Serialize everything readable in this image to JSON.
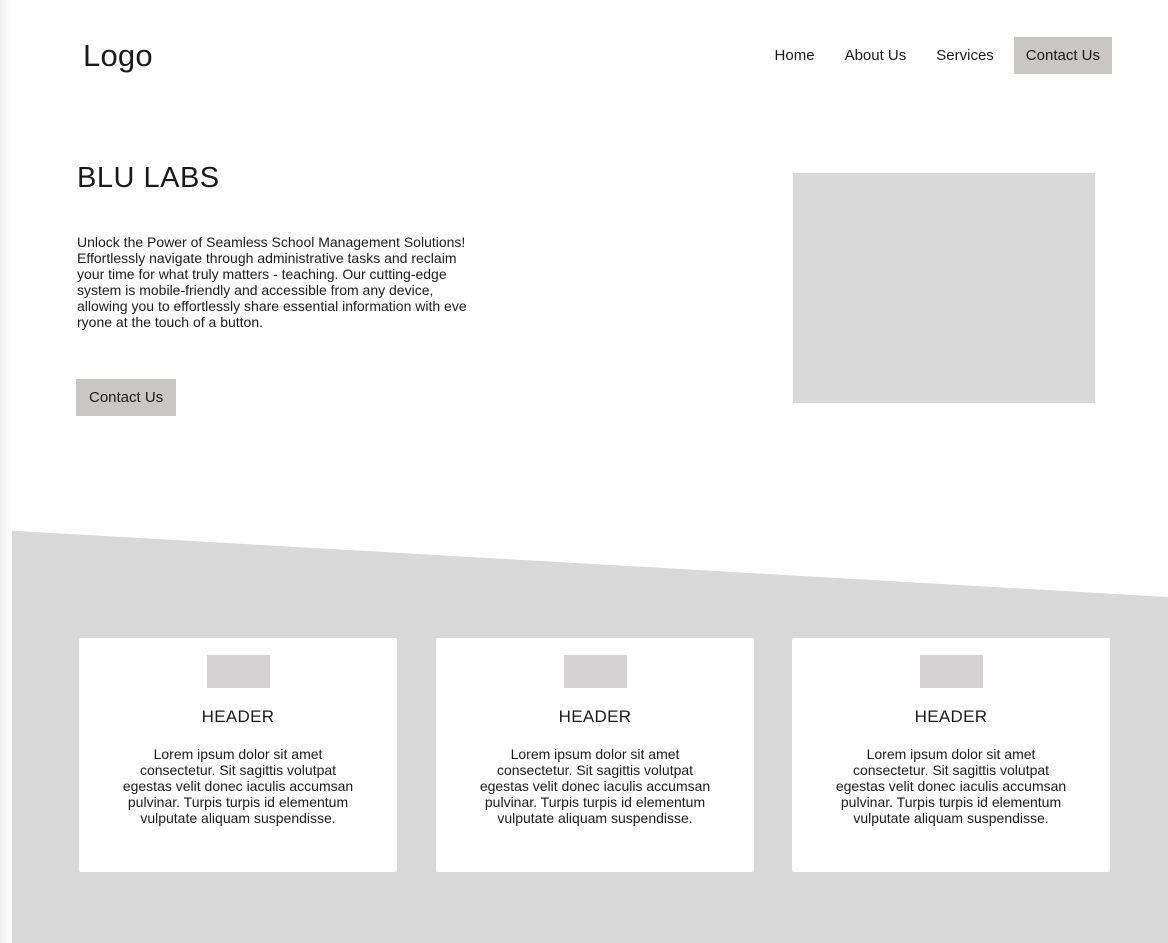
{
  "header": {
    "logo": "Logo",
    "nav": [
      {
        "label": "Home"
      },
      {
        "label": "About Us"
      },
      {
        "label": "Services"
      },
      {
        "label": "Contact Us"
      }
    ]
  },
  "hero": {
    "title": "BLU LABS",
    "description": "Unlock the Power of Seamless School Management Solutions!\nEffortlessly navigate through administrative tasks and reclaim\nyour time for what truly matters - teaching. Our cutting-edge\nsystem is mobile-friendly and accessible from any device,\n allowing you to effortlessly share essential information with eve\nryone at the touch of a button.",
    "button_label": "Contact Us"
  },
  "features": [
    {
      "header": "HEADER",
      "text": "Lorem ipsum dolor sit amet\nconsectetur. Sit sagittis volutpat\negestas velit donec iaculis accumsan\npulvinar. Turpis turpis id elementum\nvulputate aliquam suspendisse."
    },
    {
      "header": "HEADER",
      "text": "Lorem ipsum dolor sit amet\nconsectetur. Sit sagittis volutpat\negestas velit donec iaculis accumsan\npulvinar. Turpis turpis id elementum\nvulputate aliquam suspendisse."
    },
    {
      "header": "HEADER",
      "text": "Lorem ipsum dolor sit amet\nconsectetur. Sit sagittis volutpat\negestas velit donec iaculis accumsan\npulvinar. Turpis turpis id elementum\nvulputate aliquam suspendisse."
    }
  ],
  "colors": {
    "button_bg": "#c9c6c5",
    "band_bg": "#d9d9d9",
    "placeholder": "#d9d9d9",
    "card_bg": "#ffffff"
  }
}
